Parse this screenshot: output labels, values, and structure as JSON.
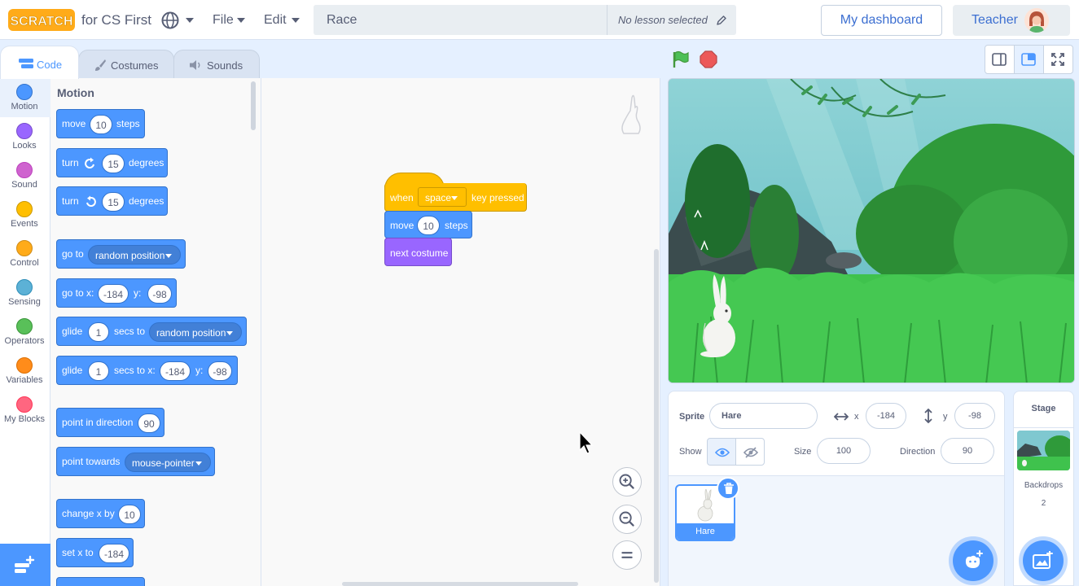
{
  "menubar": {
    "logo_text": "SCRATCH",
    "logo_suffix": "for CS First",
    "file_label": "File",
    "edit_label": "Edit",
    "project_title": "Race",
    "lesson_status": "No lesson selected",
    "dashboard_label": "My dashboard",
    "teacher_label": "Teacher"
  },
  "tabs": [
    {
      "label": "Code",
      "active": true
    },
    {
      "label": "Costumes",
      "active": false
    },
    {
      "label": "Sounds",
      "active": false
    }
  ],
  "categories": [
    {
      "label": "Motion",
      "color": "#4c97ff"
    },
    {
      "label": "Looks",
      "color": "#9966ff"
    },
    {
      "label": "Sound",
      "color": "#cf63cf"
    },
    {
      "label": "Events",
      "color": "#ffbf00"
    },
    {
      "label": "Control",
      "color": "#ffab19"
    },
    {
      "label": "Sensing",
      "color": "#5cb1d6"
    },
    {
      "label": "Operators",
      "color": "#59c059"
    },
    {
      "label": "Variables",
      "color": "#ff8c1a"
    },
    {
      "label": "My Blocks",
      "color": "#ff6680"
    }
  ],
  "palette": {
    "title": "Motion",
    "move": {
      "a": "move",
      "v": "10",
      "b": "steps"
    },
    "turn_right": {
      "a": "turn",
      "v": "15",
      "b": "degrees"
    },
    "turn_left": {
      "a": "turn",
      "v": "15",
      "b": "degrees"
    },
    "goto": {
      "a": "go to",
      "opt": "random position"
    },
    "goto_xy": {
      "a": "go to x:",
      "x": "-184",
      "ylabel": "y:",
      "y": "-98"
    },
    "glide_to": {
      "a": "glide",
      "v": "1",
      "b": "secs to",
      "opt": "random position"
    },
    "glide_xy": {
      "a": "glide",
      "v": "1",
      "b": "secs to x:",
      "x": "-184",
      "ylabel": "y:",
      "y": "-98"
    },
    "point_dir": {
      "a": "point in direction",
      "v": "90"
    },
    "point_towards": {
      "a": "point towards",
      "opt": "mouse-pointer"
    },
    "change_x": {
      "a": "change x by",
      "v": "10"
    },
    "set_x": {
      "a": "set x to",
      "v": "-184"
    }
  },
  "script": {
    "hat": {
      "a": "when",
      "key": "space",
      "b": "key pressed"
    },
    "move": {
      "a": "move",
      "v": "10",
      "b": "steps"
    },
    "next_costume": "next costume"
  },
  "sprite_info": {
    "sprite_label": "Sprite",
    "sprite_name": "Hare",
    "x_label": "x",
    "x": "-184",
    "y_label": "y",
    "y": "-98",
    "show_label": "Show",
    "size_label": "Size",
    "size": "100",
    "direction_label": "Direction",
    "direction": "90"
  },
  "sprites": [
    {
      "name": "Hare",
      "selected": true
    }
  ],
  "stage_selector": {
    "title": "Stage",
    "backdrops_label": "Backdrops",
    "backdrops_count": "2"
  }
}
